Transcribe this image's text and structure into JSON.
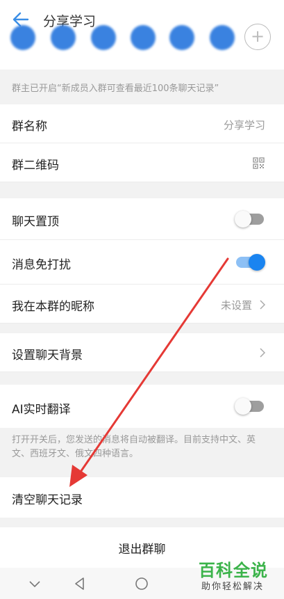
{
  "header": {
    "title": "分享学习",
    "back_icon": "arrow-left-icon",
    "add_member_icon": "plus-icon"
  },
  "notice": "群主已开启“新成员入群可查看最近100条聊天记录”",
  "settings": {
    "group_name": {
      "label": "群名称",
      "value": "分享学习"
    },
    "group_qr": {
      "label": "群二维码",
      "icon": "qr-code-icon"
    },
    "pin_chat": {
      "label": "聊天置顶",
      "on": false
    },
    "mute": {
      "label": "消息免打扰",
      "on": true
    },
    "nickname": {
      "label": "我在本群的昵称",
      "value": "未设置"
    },
    "background": {
      "label": "设置聊天背景"
    },
    "translate": {
      "label": "AI实时翻译",
      "on": false
    },
    "translate_hint": "打开开关后，您发送的消息将自动被翻译。目前支持中文、英文、西班牙文、俄文四种语言。",
    "clear_history": {
      "label": "清空聊天记录"
    }
  },
  "exit_button": "退出群聊",
  "watermark": {
    "title": "百科全说",
    "subtitle": "助你轻松解决"
  },
  "colors": {
    "accent": "#1a84f0",
    "annotation_arrow": "#e53935",
    "watermark_green": "#3bb34a"
  }
}
